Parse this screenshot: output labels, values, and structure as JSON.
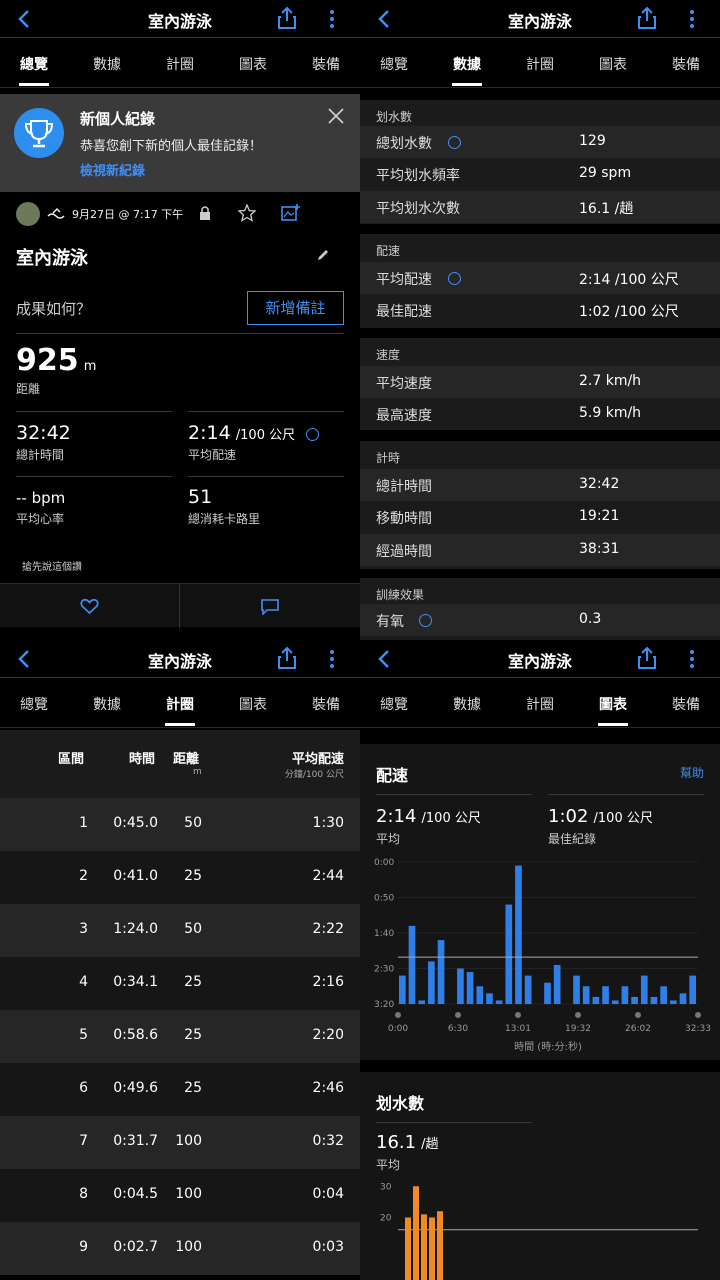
{
  "title": "室內游泳",
  "tabs": [
    "總覽",
    "數據",
    "計圈",
    "圖表",
    "裝備"
  ],
  "overview": {
    "pr": {
      "title": "新個人紀錄",
      "subtitle": "恭喜您創下新的個人最佳記錄！",
      "link": "檢視新紀錄"
    },
    "date": "9月27日 @ 7:17 下午",
    "activity_name": "室內游泳",
    "how": "成果如何？",
    "add_note": "新增備註",
    "distance": "925",
    "distance_unit": "m",
    "distance_label": "距離",
    "total_time": "32:42",
    "total_time_label": "總計時間",
    "avg_pace": "2:14",
    "avg_pace_unit": "/100 公尺",
    "avg_pace_label": "平均配速",
    "hr": "-- bpm",
    "hr_label": "平均心率",
    "cal": "51",
    "cal_label": "總消耗卡路里",
    "comment": "搶先說這個讚"
  },
  "stats": {
    "s1": "划水數",
    "total_strokes_k": "總划水數",
    "total_strokes_v": "129",
    "avg_rate_k": "平均划水頻率",
    "avg_rate_v": "29 spm",
    "avg_count_k": "平均划水次數",
    "avg_count_v": "16.1 /趟",
    "s2": "配速",
    "avg_pace_k": "平均配速",
    "avg_pace_v": "2:14 /100 公尺",
    "best_pace_k": "最佳配速",
    "best_pace_v": "1:02 /100 公尺",
    "s3": "速度",
    "avg_speed_k": "平均速度",
    "avg_speed_v": "2.7 km/h",
    "max_speed_k": "最高速度",
    "max_speed_v": "5.9 km/h",
    "s4": "計時",
    "tt_k": "總計時間",
    "tt_v": "32:42",
    "mt_k": "移動時間",
    "mt_v": "19:21",
    "et_k": "經過時間",
    "et_v": "38:31",
    "s5": "訓練效果",
    "aer_k": "有氧",
    "aer_v": "0.3"
  },
  "laps": {
    "h_lap": "區間",
    "h_time": "時間",
    "h_dist": "距離",
    "h_dist_unit": "m",
    "h_pace": "平均配速",
    "h_pace_unit": "分鐘/100 公尺",
    "rows": [
      {
        "n": "1",
        "t": "0:45.0",
        "d": "50",
        "p": "1:30"
      },
      {
        "n": "2",
        "t": "0:41.0",
        "d": "25",
        "p": "2:44"
      },
      {
        "n": "3",
        "t": "1:24.0",
        "d": "50",
        "p": "2:22"
      },
      {
        "n": "4",
        "t": "0:34.1",
        "d": "25",
        "p": "2:16"
      },
      {
        "n": "5",
        "t": "0:58.6",
        "d": "25",
        "p": "2:20"
      },
      {
        "n": "6",
        "t": "0:49.6",
        "d": "25",
        "p": "2:46"
      },
      {
        "n": "7",
        "t": "0:31.7",
        "d": "100",
        "p": "0:32"
      },
      {
        "n": "8",
        "t": "0:04.5",
        "d": "100",
        "p": "0:04"
      },
      {
        "n": "9",
        "t": "0:02.7",
        "d": "100",
        "p": "0:03"
      }
    ]
  },
  "charts": {
    "pace_title": "配速",
    "help": "幫助",
    "avg_v": "2:14",
    "avg_u": "/100 公尺",
    "avg_l": "平均",
    "best_v": "1:02",
    "best_u": "/100 公尺",
    "best_l": "最佳紀錄",
    "stroke_title": "划水數",
    "stroke_v": "16.1",
    "stroke_u": "/趟",
    "stroke_l": "平均"
  },
  "chart_data": [
    {
      "type": "bar",
      "title": "配速",
      "xlabel": "時間 (時:分:秒)",
      "x_ticks": [
        "0:00",
        "6:30",
        "13:01",
        "19:32",
        "26:02",
        "32:33"
      ],
      "y_ticks": [
        "0:00",
        "0:50",
        "1:40",
        "2:30",
        "3:20"
      ],
      "y_reversed": true,
      "avg_line": "2:14",
      "values_sec_per_100m": [
        160,
        90,
        195,
        140,
        110,
        200,
        150,
        155,
        175,
        185,
        195,
        60,
        5,
        160,
        220,
        170,
        145,
        200,
        160,
        175,
        190,
        175,
        195,
        175,
        190,
        160,
        190,
        175,
        195,
        185,
        160
      ]
    },
    {
      "type": "bar",
      "title": "划水數",
      "y_ticks": [
        "30",
        "20"
      ],
      "avg_line": 16.1,
      "values": [
        20,
        30,
        21,
        20,
        22
      ]
    }
  ],
  "colors": {
    "accent": "#3e8ff2",
    "pace_bar": "#2f7fe6",
    "stroke_bar": "#f08a24"
  }
}
